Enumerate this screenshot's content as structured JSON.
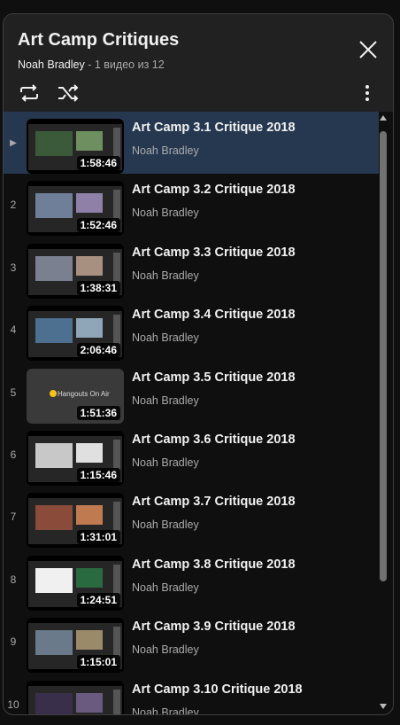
{
  "playlist": {
    "title": "Art Camp Critiques",
    "owner": "Noah Bradley",
    "position_text": "- 1 видео из 12"
  },
  "icons": {
    "close": "close-icon",
    "loop": "loop-icon",
    "shuffle": "shuffle-icon",
    "more": "more-vert-icon",
    "now_playing": "play-arrow-icon"
  },
  "colors": {
    "active_row": "#263850",
    "header_bg": "#212121"
  },
  "items": [
    {
      "index": "▶",
      "title": "Art Camp 3.1 Critique 2018",
      "channel": "Noah Bradley",
      "duration": "1:58:46",
      "active": true
    },
    {
      "index": "2",
      "title": "Art Camp 3.2 Critique 2018",
      "channel": "Noah Bradley",
      "duration": "1:52:46"
    },
    {
      "index": "3",
      "title": "Art Camp 3.3 Critique 2018",
      "channel": "Noah Bradley",
      "duration": "1:38:31"
    },
    {
      "index": "4",
      "title": "Art Camp 3.4 Critique 2018",
      "channel": "Noah Bradley",
      "duration": "2:06:46"
    },
    {
      "index": "5",
      "title": "Art Camp 3.5 Critique 2018",
      "channel": "Noah Bradley",
      "duration": "1:51:36",
      "thumb_text": "Hangouts On Air"
    },
    {
      "index": "6",
      "title": "Art Camp 3.6 Critique 2018",
      "channel": "Noah Bradley",
      "duration": "1:15:46"
    },
    {
      "index": "7",
      "title": "Art Camp 3.7 Critique 2018",
      "channel": "Noah Bradley",
      "duration": "1:31:01"
    },
    {
      "index": "8",
      "title": "Art Camp 3.8 Critique 2018",
      "channel": "Noah Bradley",
      "duration": "1:24:51"
    },
    {
      "index": "9",
      "title": "Art Camp 3.9 Critique 2018",
      "channel": "Noah Bradley",
      "duration": "1:15:01"
    },
    {
      "index": "10",
      "title": "Art Camp 3.10 Critique 2018",
      "channel": "Noah Bradley",
      "duration": ""
    }
  ]
}
